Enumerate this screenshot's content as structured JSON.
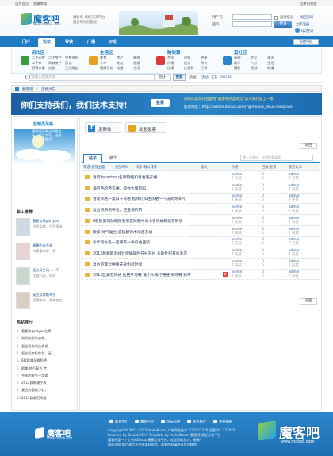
{
  "topbar": {
    "home": "设为首页",
    "fav": "收藏本站",
    "skin": "切换到宽版"
  },
  "logo": {
    "text": "魔客吧",
    "url": "www.moke8.com"
  },
  "slogan": [
    "魔客吧-模板交流平台",
    "魔客吧体验模板"
  ],
  "login": {
    "user_label": "用户名",
    "pass_label": "密码",
    "remember": "自动登录",
    "find_pass": "找回密码",
    "login_btn": "登录",
    "register": "立即注册",
    "qq_login": "QQ登录"
  },
  "nav": {
    "items": [
      "门户",
      "论坛",
      "导读",
      "广播",
      "沙龙"
    ],
    "active": 1,
    "quick": "快捷导航"
  },
  "categories": [
    {
      "title": "闲市区",
      "links": [
        [
          "二手闲置",
          "二手房产",
          "免费发布"
        ],
        [
          "二手车",
          "同城房产",
          "搭讪"
        ],
        [
          "招聘求职",
          "自我",
          "生活服务"
        ]
      ],
      "color": "#3c9b3c"
    },
    {
      "title": "生活区",
      "links": [
        [
          "美食",
          "房产",
          "装修"
        ],
        [
          "人才",
          "交友",
          "旅游"
        ],
        [
          "健康活动",
          "结婚",
          "生活"
        ]
      ],
      "color": "#e8a321"
    },
    {
      "title": "购实惠",
      "links": [
        [
          "淘宝",
          "团购",
          "晒单"
        ],
        [
          "价格",
          "比价",
          "特价"
        ],
        [
          "优惠",
          "优惠券",
          "打折"
        ]
      ],
      "color": "#d83b3b"
    },
    {
      "title": "逛社区",
      "links": [
        [
          "闲聊",
          "交友",
          "灌水"
        ],
        [
          "娱乐",
          "八卦",
          "生活"
        ],
        [
          "摄影",
          "视频",
          "动漫"
        ]
      ],
      "color": "#2a86c9"
    }
  ],
  "search": {
    "placeholder": "请输入搜索内容",
    "type": "帖子",
    "button": "搜索",
    "hot_label": "热搜:",
    "hot": [
      "活动",
      "交友",
      "discuz"
    ]
  },
  "breadcrumb": [
    "魔客吧",
    "蓝精灵向"
  ],
  "banner": {
    "headline": "你们支持我们，我们技术支持！",
    "button": "投票",
    "line1": "如果你喜欢并且使用“魔客吧的蓝精灵”请为我们投上一票",
    "line2": "投票地址：http://addon.discuz.com/?@moke8_sblue.template"
  },
  "sidebar": {
    "forum_name": "蓝精灵风格",
    "forum_desc": [
      "魔客吧蓝精灵风格设",
      "计，简洁大气，适合",
      "各类站点使用"
    ],
    "new_title": "新＋推荐",
    "recommend": [
      {
        "title": "春夏女装partyou",
        "sub": "时尚女装，引领潮流"
      },
      {
        "title": "春夏的连衣裙",
        "sub": "你最喜欢哪一件"
      },
      {
        "title": "复古英伦风……平",
        "sub": "优雅气质，时尚"
      },
      {
        "title": "复古双肩帆布包",
        "sub": "质感帆布，精美做工"
      }
    ],
    "hot_title": "热帖排行",
    "hot": [
      "春夏女partyou名牌",
      "海贝的时尚衣裳，",
      "复古民族风连衣裙",
      "复古双肩帆布包，还",
      "6款欧美风格防晒",
      "欧美 帅气复古 宫",
      "今年的秋冬一定要",
      "2012款新潮手表",
      "复古的蕾丝小衫，",
      "2012欧美范风格"
    ]
  },
  "actions": {
    "post": "发新帖",
    "poll": "发起投票"
  },
  "tabs": [
    "帖子",
    "精华"
  ],
  "table": {
    "filters": [
      "筛选:全部主题",
      "全部时间",
      "排序:默认排序"
    ],
    "search_placeholder": "输入关键词，快速搜索本版",
    "headers": [
      "版块",
      "作者",
      "回复/查看",
      "最后发表"
    ],
    "rows": [
      {
        "title": "春夏女partyou名牌铜纽扣青春连衣裙",
        "author": "admin",
        "date": "7 天前",
        "reply": "0",
        "view": "0",
        "last": "admin",
        "last_date": "7 天前"
      },
      {
        "title": "海贝色的连衣裙，是你大婚的吗",
        "author": "admin",
        "date": "7 天前",
        "reply": "0",
        "view": "0",
        "last": "admin",
        "last_date": "7 天前"
      },
      {
        "title": "春夏风格—奥白千鸟格 松绿钉扣连衣裙～～法式网洋气",
        "author": "admin",
        "date": "7 天前",
        "reply": "0",
        "view": "0",
        "last": "admin",
        "last_date": "7 天前"
      },
      {
        "title": "复古双肩帆布包，还是低的的",
        "author": "admin",
        "date": "7 天前",
        "reply": "0",
        "view": "0",
        "last": "admin",
        "last_date": "7 天前"
      },
      {
        "title": "6款欧美风防晒粉底液套防晒中地小香风蝴蝶结衣裤装",
        "author": "admin",
        "date": "7 天前",
        "reply": "0",
        "view": "0",
        "last": "admin",
        "last_date": "7 天前"
      },
      {
        "title": "欧美 帅气复古 宫廷翻领木扣连衣裙",
        "author": "admin",
        "date": "7 天前",
        "reply": "0",
        "view": "0",
        "last": "admin",
        "last_date": "7 天前"
      },
      {
        "title": "今年的秋冬一定要有一件白色西装！",
        "author": "admin",
        "date": "7 天前",
        "reply": "0",
        "view": "0",
        "last": "admin",
        "last_date": "7 天前"
      },
      {
        "title": "2012款新颖毛线针织编辑时开衫开衫 长款针织开衫毛衣",
        "author": "admin",
        "date": "7 天前",
        "reply": "0",
        "view": "0",
        "last": "admin",
        "last_date": "7 天前"
      },
      {
        "title": "复古的蕾丝拼接花朵伪装时尚",
        "author": "admin",
        "date": "7 天前",
        "reply": "0",
        "view": "0",
        "last": "admin",
        "last_date": "7 天前"
      },
      {
        "title": "2012欧美范风格 拉链罗马鞋 穿小你再打鞋鞋 罗马鞋 粉带",
        "author": "admin",
        "date": "7 天前",
        "reply": "0",
        "view": "0",
        "last": "admin",
        "last_date": "7 天前"
      }
    ],
    "new_badge": "新",
    "nav_label": "返回"
  },
  "footer": {
    "links": [
      "联系我们",
      "魔客学堂",
      "论坛声明",
      "站点统计",
      "注册播报"
    ],
    "lines": [
      "Copyright © 2011-2012 moke8.com  广电网络备号: 272022236 运营QQ: 272022",
      "Powered by Discuz! X2.5 Template by moke8team 魔客吧-模板交流平台",
      "魔客吧是一个专业的Discuz模板交流平台，欢迎您的加入，谢谢！",
      "网站声明:用户观点不代表本站观点，若有侵权请联系我们删除。"
    ],
    "watermark": "魔客吧",
    "watermark_url": "www.moke8.com"
  }
}
